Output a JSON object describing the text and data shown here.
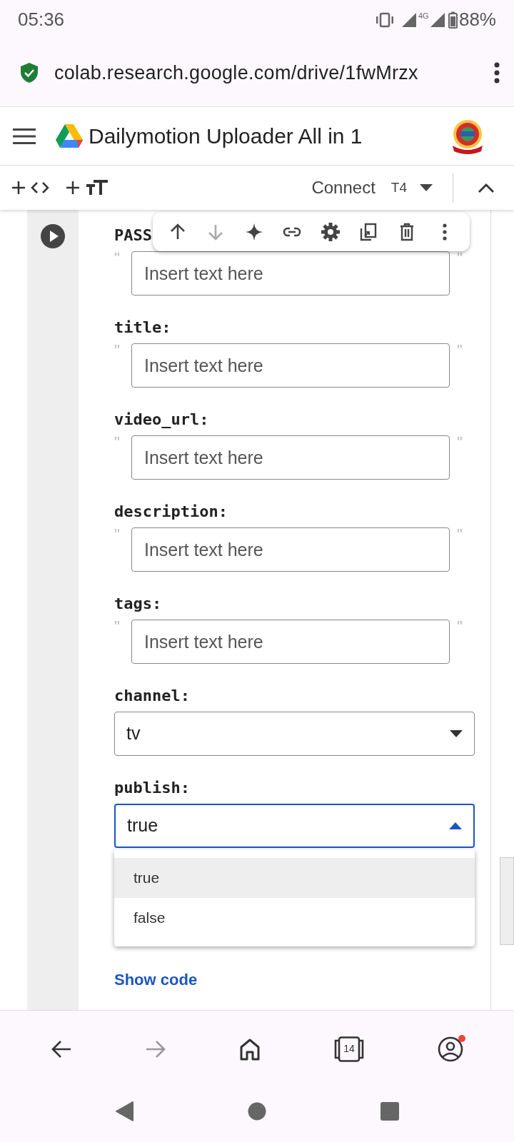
{
  "status_bar": {
    "time": "05:36",
    "network": "4G",
    "battery": "88%"
  },
  "browser": {
    "url": "colab.research.google.com/drive/1fwMrzx"
  },
  "notebook": {
    "title": "Dailymotion Uploader All in 1"
  },
  "toolbar": {
    "connect": "Connect",
    "runtime": "T4"
  },
  "cell_toolbar": [
    {
      "kind": "up",
      "disabled": false
    },
    {
      "kind": "down",
      "disabled": true
    },
    {
      "kind": "sparkle",
      "disabled": false
    },
    {
      "kind": "link",
      "disabled": false
    },
    {
      "kind": "settings",
      "disabled": false
    },
    {
      "kind": "mirror",
      "disabled": false
    },
    {
      "kind": "delete",
      "disabled": false
    },
    {
      "kind": "more",
      "disabled": false
    }
  ],
  "form": [
    {
      "kind": "text",
      "label": "PASS",
      "placeholder": "Insert text here",
      "open_quote": "\"",
      "close_quote": "\""
    },
    {
      "kind": "text",
      "label": "title:",
      "placeholder": "Insert text here",
      "open_quote": "\"",
      "close_quote": "\""
    },
    {
      "kind": "text",
      "label": "video_url:",
      "placeholder": "Insert text here",
      "open_quote": "\"",
      "close_quote": "\""
    },
    {
      "kind": "text",
      "label": "description:",
      "placeholder": "Insert text here",
      "open_quote": "\"",
      "close_quote": "\""
    },
    {
      "kind": "text",
      "label": "tags:",
      "placeholder": "Insert text here",
      "open_quote": "\"",
      "close_quote": "\""
    },
    {
      "kind": "select",
      "label": "channel:",
      "value": "tv",
      "expanded": false
    },
    {
      "kind": "select",
      "label": "publish:",
      "value": "true",
      "expanded": true,
      "options": [
        {
          "label": "true",
          "selected": true
        },
        {
          "label": "false",
          "selected": false
        }
      ]
    }
  ],
  "show_code": "Show code",
  "bottom_nav": {
    "tab_count": "14",
    "profile_notification": true
  }
}
